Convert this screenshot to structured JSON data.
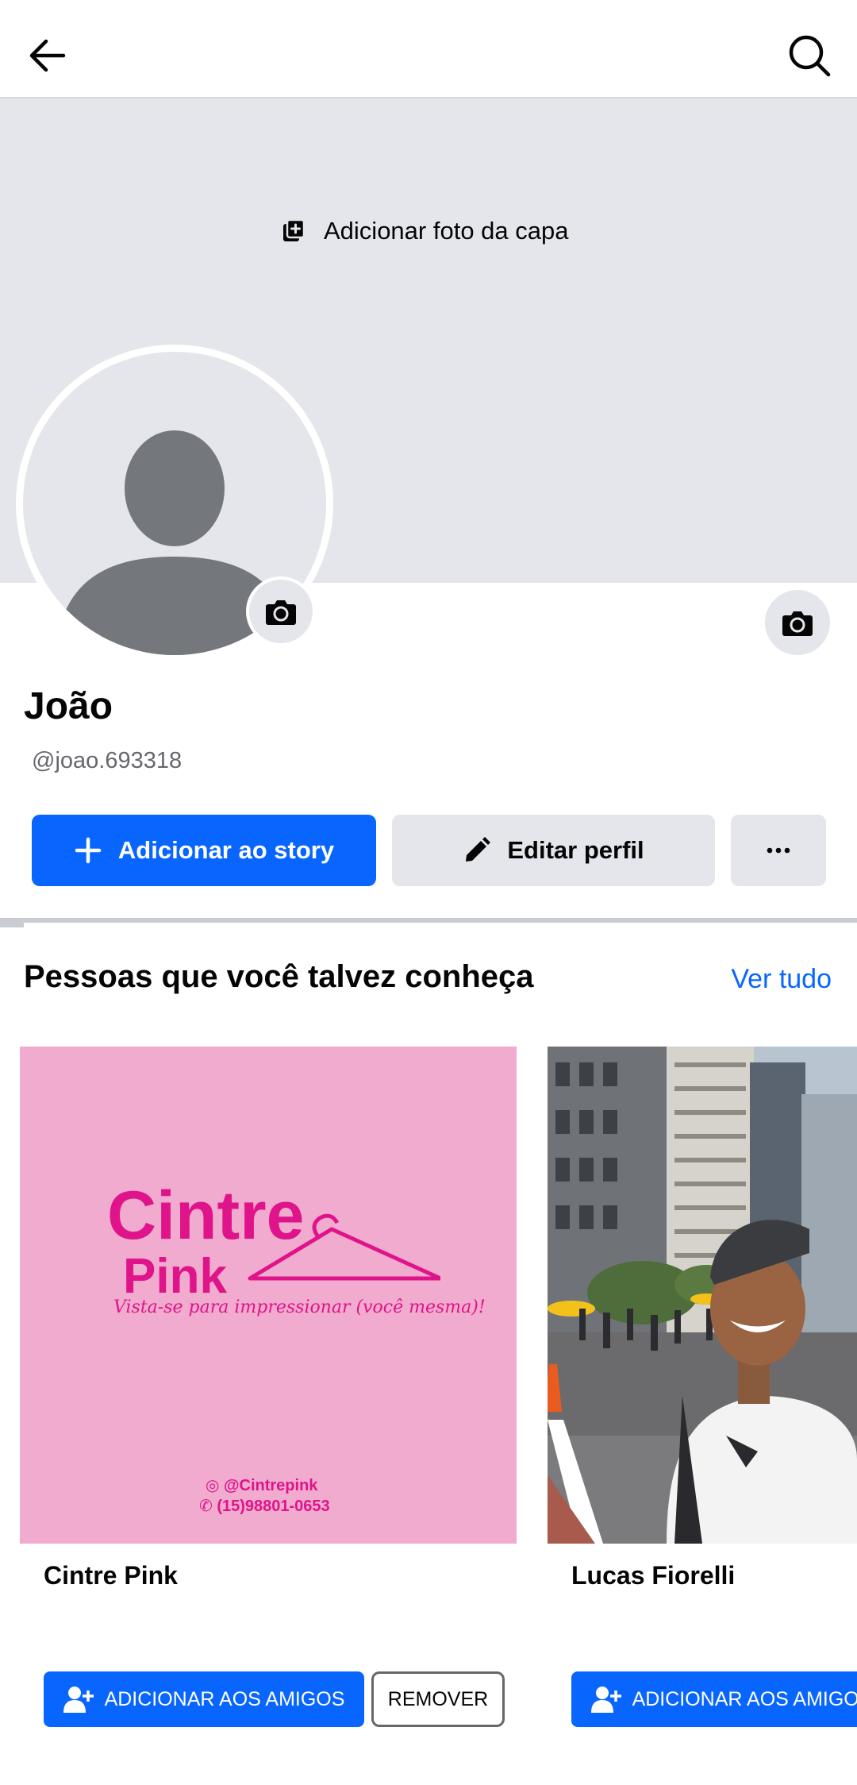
{
  "header": {
    "back_icon": "arrow-left-icon",
    "search_icon": "search-icon"
  },
  "cover": {
    "add_cover_label": "Adicionar foto da capa",
    "add_cover_icon": "add-photo-icon",
    "camera_icon": "camera-icon"
  },
  "profile": {
    "name": "João",
    "handle": "@joao.693318",
    "avatar_icon": "default-avatar-silhouette",
    "camera_icon": "camera-icon"
  },
  "actions": {
    "add_story_label": "Adicionar ao story",
    "edit_profile_label": "Editar perfil",
    "more_label": "···"
  },
  "pymk": {
    "title": "Pessoas que você talvez conheça",
    "see_all": "Ver tudo",
    "cards": [
      {
        "name": "Cintre Pink",
        "image_text": {
          "logo_line1": "Cintre",
          "logo_line2": "Pink",
          "slogan": "Vista-se para impressionar (você mesma)!",
          "instagram": "@Cintrepink",
          "whatsapp": "(15)98801-0653"
        },
        "add_label": "ADICIONAR AOS AMIGOS",
        "remove_label": "REMOVER"
      },
      {
        "name": "Lucas Fiorelli",
        "add_label": "ADICIONAR AOS AMIGOS"
      }
    ]
  },
  "colors": {
    "primary": "#0866ff",
    "cover_bg": "#e4e6eb",
    "avatar_gray": "#74777c",
    "pink_bg": "#f1abcf",
    "pink_text": "#e0148a"
  }
}
